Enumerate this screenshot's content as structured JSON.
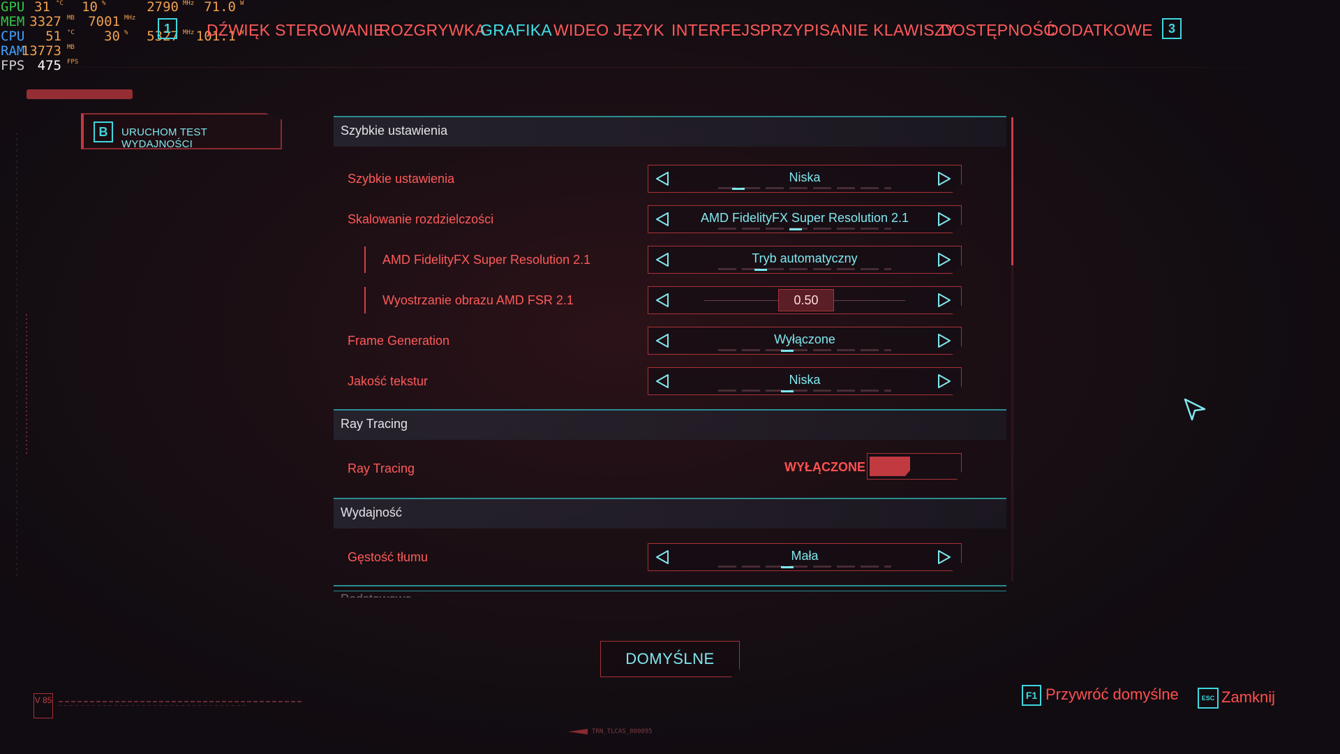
{
  "osd": {
    "rows": [
      {
        "label": "GPU",
        "cls": "lbl-gpu",
        "values": [
          {
            "v": "31",
            "u": "°C"
          },
          {
            "v": "10",
            "u": "%"
          },
          {
            "v": "2790",
            "u": "MHz"
          },
          {
            "v": "71.0",
            "u": "W"
          }
        ]
      },
      {
        "label": "MEM",
        "cls": "lbl-mem",
        "values": [
          {
            "v": "3327",
            "u": "MB"
          },
          {
            "v": "7001",
            "u": "MHz"
          }
        ]
      },
      {
        "label": "CPU",
        "cls": "lbl-cpu",
        "values": [
          {
            "v": "51",
            "u": "°C"
          },
          {
            "v": "30",
            "u": "%"
          },
          {
            "v": "5327",
            "u": "MHz"
          },
          {
            "v": "101.1",
            "u": "W"
          }
        ]
      },
      {
        "label": "RAM",
        "cls": "lbl-ram",
        "values": [
          {
            "v": "13773",
            "u": "MB"
          }
        ]
      },
      {
        "label": "FPS",
        "cls": "lbl-fps",
        "values": [
          {
            "v": "475",
            "u": "FPS"
          }
        ]
      }
    ]
  },
  "nav": {
    "prev_key": "1",
    "next_key": "3",
    "tabs": [
      {
        "label": "DŹWIĘK",
        "active": false
      },
      {
        "label": "STEROWANIE",
        "active": false
      },
      {
        "label": "ROZGRYWKA",
        "active": false
      },
      {
        "label": "GRAFIKA",
        "active": true
      },
      {
        "label": "WIDEO",
        "active": false
      },
      {
        "label": "JĘZYK",
        "active": false
      },
      {
        "label": "INTERFEJS",
        "active": false
      },
      {
        "label": "PRZYPISANIE KLAWISZY",
        "active": false
      },
      {
        "label": "DOSTĘPNOŚĆ",
        "active": false
      },
      {
        "label": "DODATKOWE",
        "active": false
      }
    ]
  },
  "benchmark": {
    "key": "B",
    "label": "URUCHOM TEST WYDAJNOŚCI"
  },
  "sections": [
    {
      "title": "Szybkie ustawienia",
      "settings": [
        {
          "label": "Szybkie ustawienia",
          "type": "selector",
          "value": "Niska",
          "sub": false
        },
        {
          "label": "Skalowanie rozdzielczości",
          "type": "selector",
          "value": "AMD FidelityFX Super Resolution 2.1",
          "sub": false
        },
        {
          "label": "AMD FidelityFX Super Resolution 2.1",
          "type": "selector",
          "value": "Tryb automatyczny",
          "sub": true
        },
        {
          "label": "Wyostrzanie obrazu AMD FSR 2.1",
          "type": "slider",
          "value": "0.50",
          "sub": true
        },
        {
          "label": "Frame Generation",
          "type": "selector",
          "value": "Wyłączone",
          "sub": false
        },
        {
          "label": "Jakość tekstur",
          "type": "selector",
          "value": "Niska",
          "sub": false
        }
      ]
    },
    {
      "title": "Ray Tracing",
      "settings": [
        {
          "label": "Ray Tracing",
          "type": "toggle",
          "value": "WYŁĄCZONE",
          "sub": false
        }
      ]
    },
    {
      "title": "Wydajność",
      "settings": [
        {
          "label": "Gęstość tłumu",
          "type": "selector",
          "value": "Mała",
          "sub": false
        }
      ]
    }
  ],
  "next_section_partial": "Podstawowe",
  "footer": {
    "defaults_button": "DOMYŚLNE",
    "restore_key": "F1",
    "restore_label": "Przywróć domyślne",
    "close_key": "ESC",
    "close_label": "Zamknij",
    "version_badge": "V 85",
    "build_code": "TRN_TLCAS_800095"
  },
  "colors": {
    "accent_cyan": "#7fe8ee",
    "accent_red": "#ff5a5a",
    "border_red": "#a83238",
    "section_line": "#2a8d94"
  }
}
